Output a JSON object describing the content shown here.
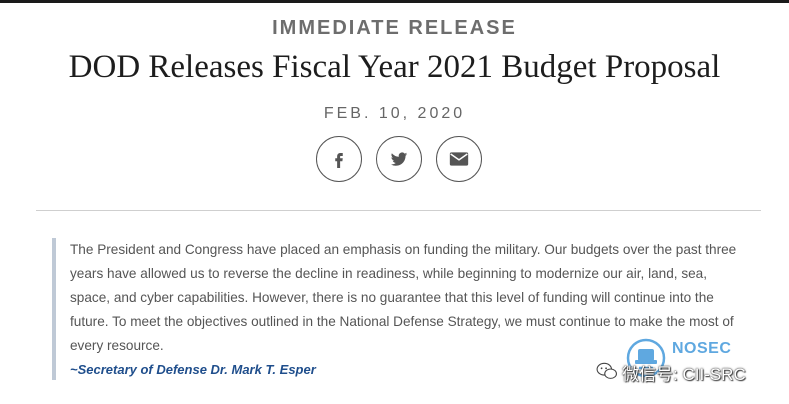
{
  "article": {
    "kicker": "IMMEDIATE RELEASE",
    "title": "DOD Releases Fiscal Year 2021 Budget Proposal",
    "date": "FEB. 10, 2020"
  },
  "share": {
    "buttons": [
      {
        "icon": "facebook-icon"
      },
      {
        "icon": "twitter-icon"
      },
      {
        "icon": "email-icon"
      }
    ]
  },
  "quote": {
    "text": "The President and Congress have placed an emphasis on funding the military. Our budgets over the past three years have allowed us to reverse the decline in readiness, while beginning to modernize our air, land, sea, space, and cyber capabilities. However, there is no guarantee that this level of funding will continue into the future. To meet the objectives outlined in the National Defense Strategy, we must continue to make the most of every resource.",
    "attribution": "~Secretary of Defense Dr. Mark T. Esper"
  },
  "watermark": {
    "brand": "NOSEC",
    "account": "微信号: CII-SRC"
  },
  "colors": {
    "headline": "#1d1d1d",
    "attribution": "#1f4e8c",
    "quote_bar": "#bfc9d6",
    "watermark_brand": "#5fa8e0"
  }
}
